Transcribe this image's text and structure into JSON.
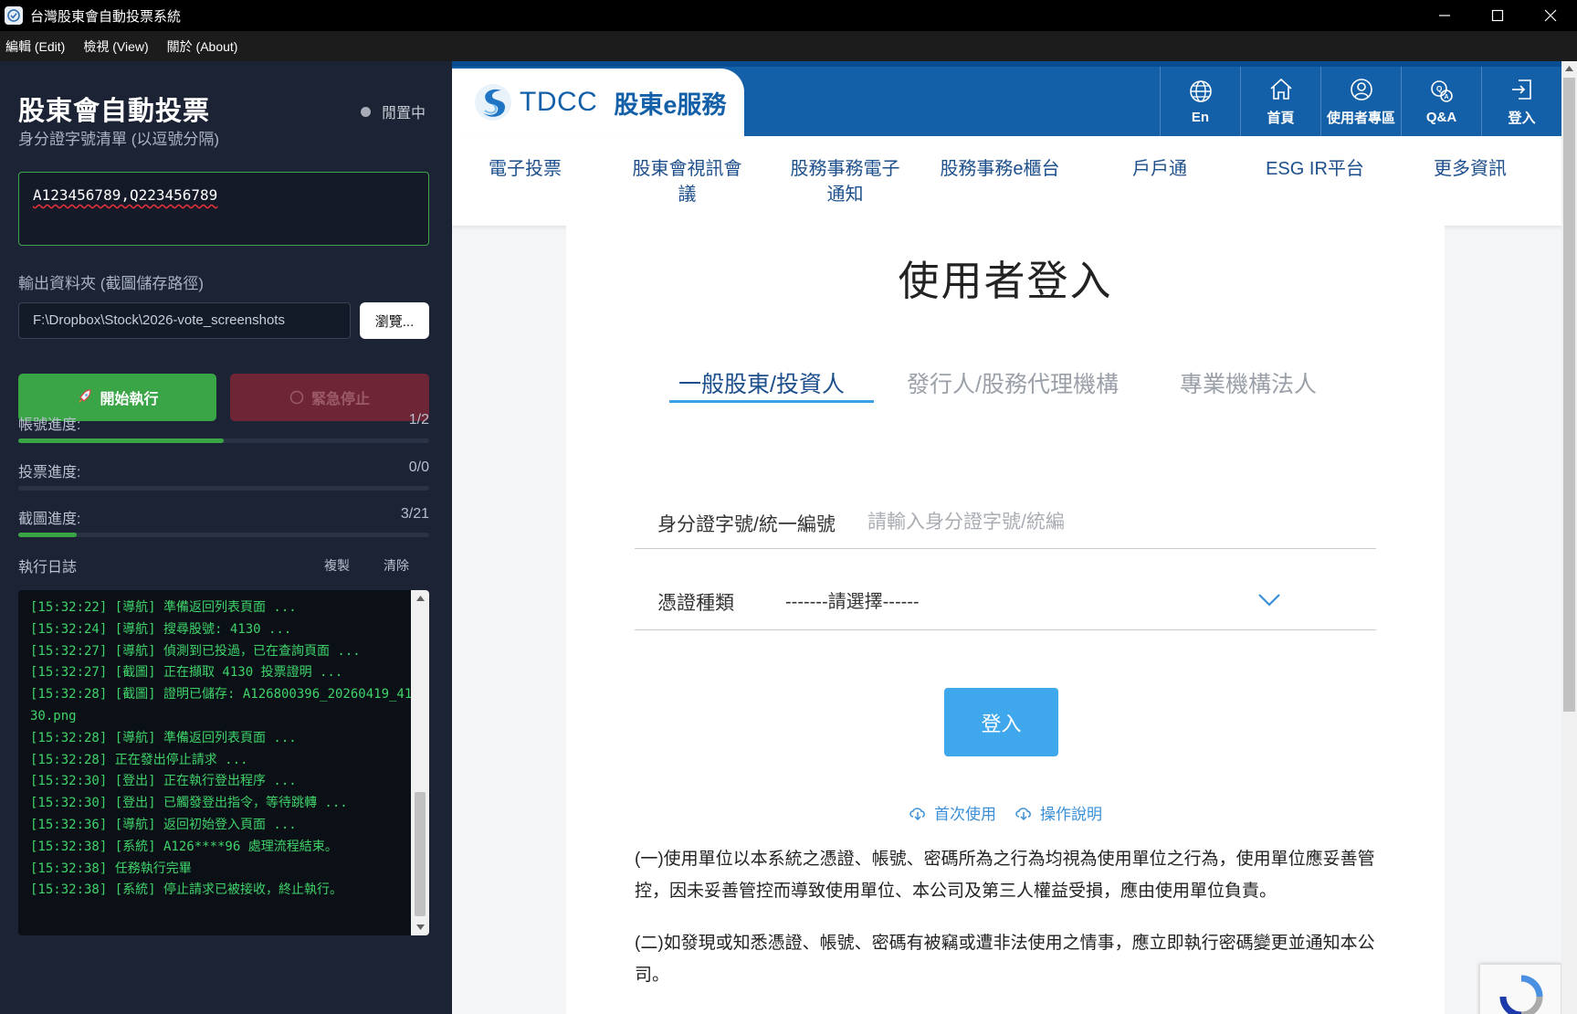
{
  "window": {
    "title": "台灣股東會自動投票系統"
  },
  "menu": {
    "items": [
      "編輯 (Edit)",
      "檢視 (View)",
      "關於 (About)"
    ]
  },
  "panel": {
    "title": "股東會自動投票",
    "status": "閒置中",
    "id_list_label": "身分證字號清單 (以逗號分隔)",
    "id_list_value": "A123456789,Q223456789",
    "output_label": "輸出資料夾 (截圖儲存路徑)",
    "output_path": "F:\\Dropbox\\Stock\\2026-vote_screenshots",
    "browse_label": "瀏覽...",
    "start_label": "開始執行",
    "stop_label": "緊急停止",
    "progress": [
      {
        "label": "帳號進度:",
        "value": "1/2",
        "fraction": 0.5
      },
      {
        "label": "投票進度:",
        "value": "0/0",
        "fraction": 0
      },
      {
        "label": "截圖進度:",
        "value": "3/21",
        "fraction": 0.143
      }
    ],
    "log_title": "執行日誌",
    "copy_label": "複製",
    "clear_label": "清除",
    "log": [
      "[15:32:22] [導航] 準備返回列表頁面 ...",
      "[15:32:24] [導航] 搜尋股號: 4130 ...",
      "[15:32:27] [導航] 偵測到已投過，已在查詢頁面 ...",
      "[15:32:27] [截圖] 正在擷取 4130 投票證明 ...",
      "[15:32:28] [截圖] 證明已儲存: A126800396_20260419_4130.png",
      "[15:32:28] [導航] 準備返回列表頁面 ...",
      "[15:32:28] 正在發出停止請求 ...",
      "[15:32:30] [登出] 正在執行登出程序 ...",
      "[15:32:30] [登出] 已觸發登出指令，等待跳轉 ...",
      "[15:32:36] [導航] 返回初始登入頁面 ...",
      "[15:32:38] [系統] A126****96 處理流程結束。",
      "[15:32:38] 任務執行完畢",
      "[15:32:38] [系統] 停止請求已被接收，終止執行。"
    ]
  },
  "web": {
    "logo_text": "TDCC",
    "logo_sub": "股東e服務",
    "top_icons": [
      {
        "label": "En",
        "icon": "globe-icon"
      },
      {
        "label": "首頁",
        "icon": "home-icon"
      },
      {
        "label": "使用者專區",
        "icon": "user-icon"
      },
      {
        "label": "Q&A",
        "icon": "qa-icon"
      },
      {
        "label": "登入",
        "icon": "login-icon"
      }
    ],
    "nav": [
      "電子投票",
      "股東會視訊會議",
      "股務事務電子通知",
      "股務事務e櫃台",
      "戶戶通",
      "ESG IR平台",
      "更多資訊"
    ],
    "login_title": "使用者登入",
    "tabs": [
      "一般股東/投資人",
      "發行人/股務代理機構",
      "專業機構法人"
    ],
    "id_label": "身分證字號/統一編號",
    "id_placeholder": "請輸入身分證字號/統編",
    "cert_label": "憑證種類",
    "cert_value": "-------請選擇------",
    "login_button": "登入",
    "link_first": "首次使用",
    "link_guide": "操作說明",
    "para1": "(一)使用單位以本系統之憑證、帳號、密碼所為之行為均視為使用單位之行為，使用單位應妥善管控，因未妥善管控而導致使用單位、本公司及第三人權益受損，應由使用單位負責。",
    "para2": "(二)如發現或知悉憑證、帳號、密碼有被竊或遭非法使用之情事，應立即執行密碼變更並通知本公司。"
  },
  "colors": {
    "accent_green": "#3aa546",
    "stop_red": "#6e2637",
    "tdcc_blue": "#1460a8",
    "login_blue": "#3fa8ec"
  }
}
